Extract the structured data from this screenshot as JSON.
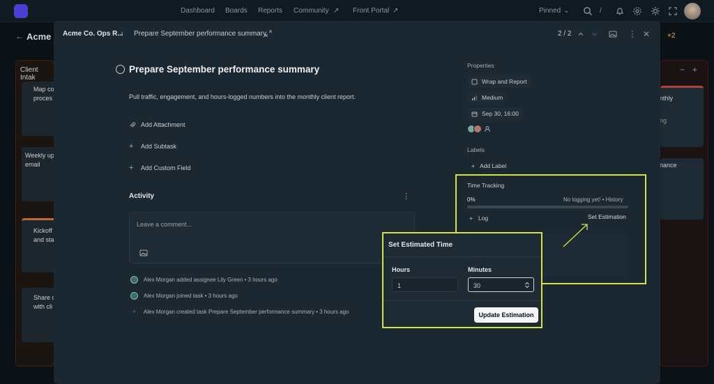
{
  "topbar": {
    "nav": [
      "Dashboard",
      "Boards",
      "Reports",
      "Community",
      "Front Portal"
    ],
    "pinned": "Pinned"
  },
  "board": {
    "title": "Acme C",
    "left_col_title": "Client Intak",
    "left_cards": [
      "Map co\nproces",
      "Weekly up\nemail",
      "Kickoff\nand sta",
      "Share c\nwith cli"
    ],
    "right_cards": [
      "nthly",
      "ng",
      "nance"
    ],
    "badge": "+2"
  },
  "modal": {
    "workspace": "Acme Co. Ops R...",
    "breadcrumb_task": "Prepare September performance summary",
    "pager": "2 / 2",
    "title": "Prepare September performance summary",
    "description": "Pull traffic, engagement, and hours-logged numbers into the monthly client report.",
    "actions": [
      "Add Attachment",
      "Add Subtask",
      "Add Custom Field"
    ],
    "activity_title": "Activity",
    "comment_placeholder": "Leave a comment...",
    "activity_log": [
      "Alex Morgan added assignee Lily Green • 3 hours ago",
      "Alex Morgan joined task • 3 hours ago",
      "Alex Morgan created task Prepare September performance summary • 3 hours ago"
    ]
  },
  "properties": {
    "title": "Properties",
    "stage": "Wrap and Report",
    "priority": "Medium",
    "due": "Sep 30, 16:00",
    "labels_title": "Labels",
    "add_label": "Add Label"
  },
  "time_tracking": {
    "title": "Time Tracking",
    "percent_text": "0%",
    "percent_value": 0,
    "status": "No logging yet! • History",
    "log_label": "Log",
    "set_estimation": "Set Estimation"
  },
  "popup": {
    "title": "Set Estimated Time",
    "hours_label": "Hours",
    "hours_value": "1",
    "minutes_label": "Minutes",
    "minutes_value": "30",
    "button": "Update Estimation"
  },
  "colors": {
    "highlight": "#d5e34a",
    "accent": "#7c88ff"
  }
}
